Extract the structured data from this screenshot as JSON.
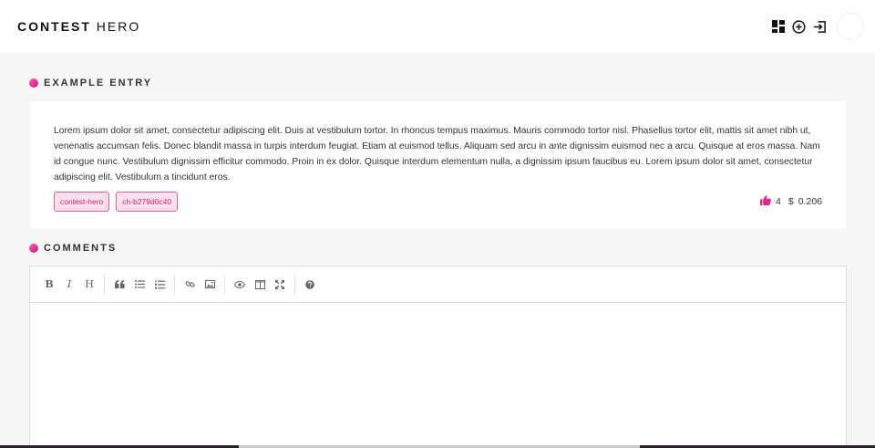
{
  "header": {
    "brand_bold": "CONTEST",
    "brand_light": " HERO"
  },
  "icons": {
    "dashboard": "dashboard-icon",
    "add": "add-circle-icon",
    "logout": "logout-icon"
  },
  "entry": {
    "section_title": "EXAMPLE ENTRY",
    "body": "Lorem ipsum dolor sit amet, consectetur adipiscing elit. Duis at vestibulum tortor. In rhoncus tempus maximus. Mauris commodo tortor nisl. Phasellus tortor elit, mattis sit amet nibh ut, venenatis accumsan felis. Donec blandit massa in turpis interdum feugiat. Etiam at euismod tellus. Aliquam sed arcu in ante dignissim euismod nec a arcu. Quisque at eros massa. Nam id congue nunc. Vestibulum dignissim efficitur commodo. Proin in ex dolor. Quisque interdum elementum nulla, a dignissim ipsum faucibus eu. Lorem ipsum dolor sit amet, consectetur adipiscing elit. Vestibulum a tincidunt eros.",
    "tags": [
      "contest-hero",
      "ch-b279d0c40"
    ],
    "votes": "4",
    "currency": "$",
    "payout": "0.206"
  },
  "comments": {
    "section_title": "COMMENTS",
    "toolbar": {
      "bold": "B",
      "italic": "I",
      "heading": "H"
    }
  },
  "colors": {
    "accent": "#e0288a",
    "tag_bg": "#fde0ee",
    "tag_text": "#d0256f"
  }
}
